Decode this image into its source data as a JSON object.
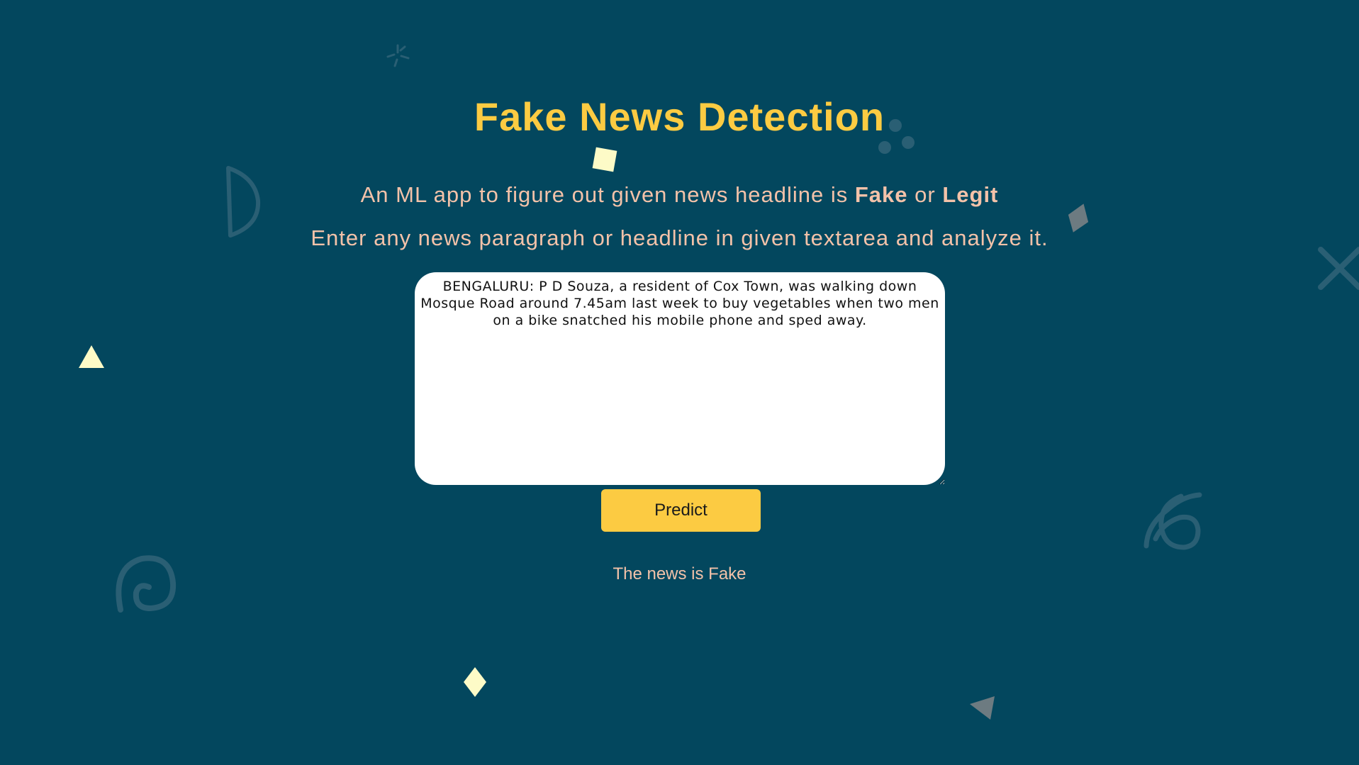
{
  "page": {
    "title": "Fake News Detection",
    "subtitle_prefix": "An ML app to figure out given news headline is ",
    "subtitle_fake": "Fake",
    "subtitle_or": " or ",
    "subtitle_legit": "Legit",
    "instruction": "Enter any news paragraph or headline in given textarea and analyze it."
  },
  "form": {
    "news_text": "BENGALURU: P D Souza, a resident of Cox Town, was walking down Mosque Road around 7.45am last week to buy vegetables when two men on a bike snatched his mobile phone and sped away.",
    "predict_label": "Predict"
  },
  "result": {
    "text": "The news is Fake"
  },
  "colors": {
    "background": "#03475e",
    "accent": "#fccb42",
    "text_peach": "#f3c2a9",
    "decor_dark": "#2a5f74",
    "decor_grey": "#6d7b81",
    "decor_cream": "#fdfbc7"
  },
  "decorations": [
    "sparkle-icon",
    "dots-cluster-icon",
    "cream-square-icon",
    "half-moon-outline-icon",
    "grey-diamond-icon",
    "x-cross-icon",
    "cream-triangle-icon",
    "swirl-icon",
    "loop-squiggle-icon",
    "cream-diamond-icon",
    "grey-triangle-icon"
  ]
}
